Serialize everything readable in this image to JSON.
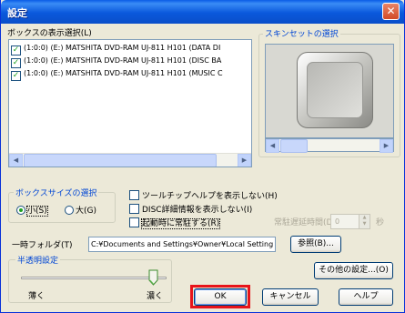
{
  "window": {
    "title": "設定",
    "close_glyph": "✕"
  },
  "box_display": {
    "title": "ボックスの表示選択(L)",
    "items": [
      {
        "checked": true,
        "label": "(1:0:0) (E:) MATSHITA DVD-RAM UJ-811 H101 (DATA DI"
      },
      {
        "checked": true,
        "label": "(1:0:0) (E:) MATSHITA DVD-RAM UJ-811 H101 (DISC BA"
      },
      {
        "checked": true,
        "label": "(1:0:0) (E:) MATSHITA DVD-RAM UJ-811 H101 (MUSIC C"
      }
    ]
  },
  "skin_set": {
    "title": "スキンセットの選択"
  },
  "box_size": {
    "title": "ボックスサイズの選択",
    "options": [
      {
        "label": "小(S)",
        "selected": true
      },
      {
        "label": "大(G)",
        "selected": false
      }
    ]
  },
  "options": {
    "no_tooltip": {
      "label": "ツールチップヘルプを表示しない(H)",
      "checked": false
    },
    "no_disc_info": {
      "label": "DISC詳細情報を表示しない(I)",
      "checked": false
    },
    "resident_startup": {
      "label": "起動時に常駐する(R)",
      "checked": false
    },
    "resident_delay_label": "常駐遅延時間(D)",
    "resident_delay_value": "0",
    "resident_delay_unit": "秒"
  },
  "temp_folder": {
    "label": "一時フォルダ(T)",
    "value": "C:¥Documents and Settings¥Owner¥Local Setting",
    "browse_label": "参照(B)..."
  },
  "transparency": {
    "title": "半透明設定",
    "min_label": "薄く",
    "max_label": "濃く",
    "level": 1.0
  },
  "buttons": {
    "other_settings": "その他の設定...(O)",
    "ok": "OK",
    "cancel": "キャンセル",
    "help": "ヘルプ"
  },
  "colors": {
    "title_bar": "#0a58dc",
    "group_title_blue": "#0046d5",
    "highlight": "#e8141a"
  }
}
